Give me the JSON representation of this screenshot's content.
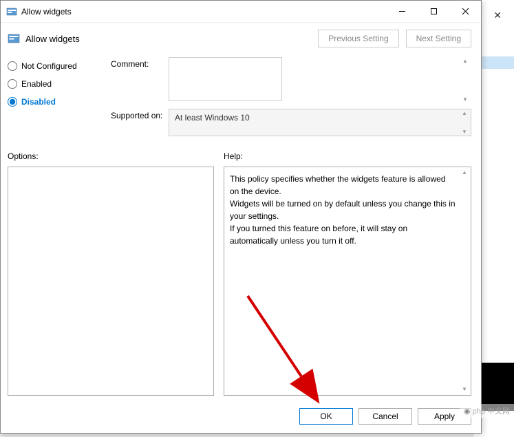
{
  "titlebar": {
    "title": "Allow widgets"
  },
  "header": {
    "title": "Allow widgets",
    "previous_setting": "Previous Setting",
    "next_setting": "Next Setting"
  },
  "radios": {
    "not_configured": "Not Configured",
    "enabled": "Enabled",
    "disabled": "Disabled",
    "selected": "disabled"
  },
  "config": {
    "comment_label": "Comment:",
    "comment_value": "",
    "supported_label": "Supported on:",
    "supported_value": "At least Windows 10"
  },
  "lower": {
    "options_label": "Options:",
    "help_label": "Help:",
    "help_text": "This policy specifies whether the widgets feature is allowed on the device.\nWidgets will be turned on by default unless you change this in your settings.\nIf you turned this feature on before, it will stay on automatically unless you turn it off."
  },
  "footer": {
    "ok": "OK",
    "cancel": "Cancel",
    "apply": "Apply"
  },
  "watermark": "php 中文网"
}
